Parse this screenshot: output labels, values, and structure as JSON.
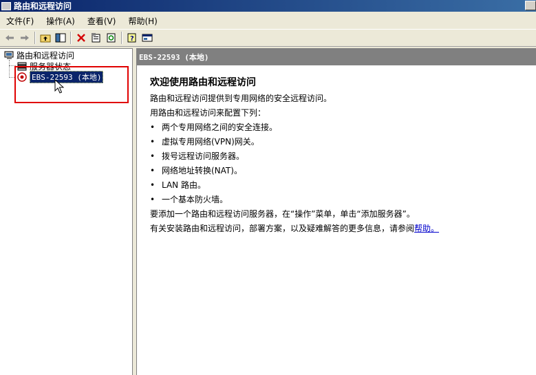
{
  "window": {
    "title": "路由和远程访问"
  },
  "menu": {
    "items": [
      {
        "label": "文件(F)"
      },
      {
        "label": "操作(A)"
      },
      {
        "label": "查看(V)"
      },
      {
        "label": "帮助(H)"
      }
    ]
  },
  "toolbar": {
    "back_icon": "arrow-left-icon",
    "forward_icon": "arrow-right-icon",
    "up_icon": "up-folder-icon",
    "show_tree_icon": "show-hide-tree-icon",
    "delete_icon": "delete-x-icon",
    "properties_icon": "properties-icon",
    "refresh_icon": "refresh-icon",
    "help_icon": "help-icon",
    "console_icon": "console-icon"
  },
  "tree": {
    "root": "路由和远程访问",
    "items": [
      {
        "label": "服务器状态"
      },
      {
        "label": "EBS-22593 (本地)"
      }
    ]
  },
  "content": {
    "header": "EBS-22593 (本地)",
    "title": "欢迎使用路由和远程访问",
    "intro": "路由和远程访问提供到专用网络的安全远程访问。",
    "config_intro": "用路由和远程访问来配置下列：",
    "bullets": [
      "两个专用网络之间的安全连接。",
      "虚拟专用网络(VPN)网关。",
      "拨号远程访问服务器。",
      "网络地址转换(NAT)。",
      "LAN 路由。",
      "一个基本防火墙。"
    ],
    "add_server": "要添加一个路由和远程访问服务器，在“操作”菜单，单击“添加服务器”。",
    "more_info": "有关安装路由和远程访问，部署方案，以及疑难解答的更多信息，请参阅",
    "help_link": "帮助。"
  },
  "colors": {
    "selection": "#0a246a",
    "highlight_box": "#e00000",
    "link": "#0000cc"
  }
}
